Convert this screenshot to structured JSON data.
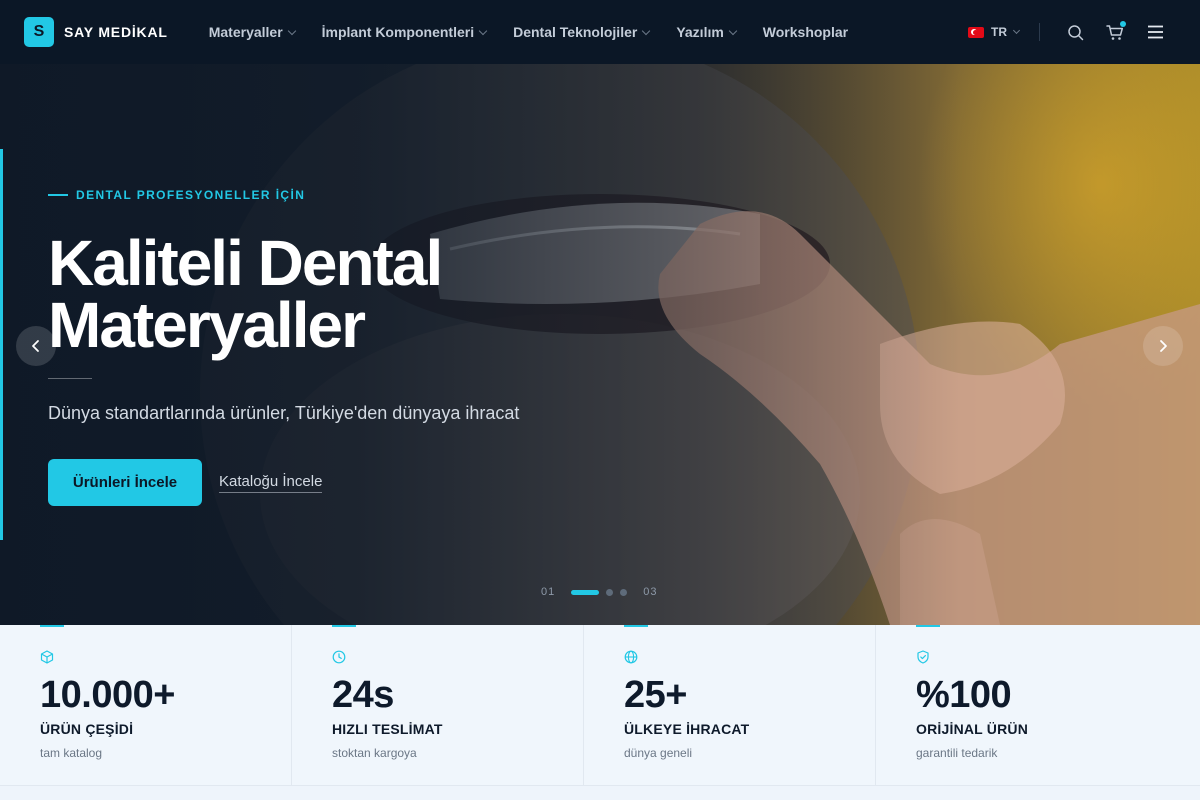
{
  "brand": {
    "logo_letter": "S",
    "name": "SAY MEDİKAL"
  },
  "nav": {
    "items": [
      {
        "label": "Materyaller",
        "has_dropdown": true
      },
      {
        "label": "İmplant Komponentleri",
        "has_dropdown": true
      },
      {
        "label": "Dental Teknolojiler",
        "has_dropdown": true
      },
      {
        "label": "Yazılım",
        "has_dropdown": true
      },
      {
        "label": "Workshoplar",
        "has_dropdown": false
      }
    ]
  },
  "header_actions": {
    "language": "TR",
    "icons": [
      "search-icon",
      "cart-icon",
      "menu-icon"
    ],
    "cart_has_items": true
  },
  "hero": {
    "eyebrow": "DENTAL PROFESYONELLER İÇİN",
    "title": "Kaliteli Dental Materyaller",
    "subtitle": "Dünya standartlarında ürünler, Türkiye'den dünyaya ihracat",
    "primary_cta": "Ürünleri İncele",
    "secondary_cta": "Kataloğu İncele",
    "slider": {
      "current_label": "01",
      "total_label": "03",
      "active_index": 0,
      "count": 3
    }
  },
  "stats": [
    {
      "icon": "box-icon",
      "value": "10.000+",
      "label": "ÜRÜN ÇEŞİDİ",
      "sub": "tam katalog"
    },
    {
      "icon": "clock-icon",
      "value": "24s",
      "label": "HIZLI TESLİMAT",
      "sub": "stoktan kargoya"
    },
    {
      "icon": "globe-icon",
      "value": "25+",
      "label": "ÜLKEYE İHRACAT",
      "sub": "dünya geneli"
    },
    {
      "icon": "shield-check-icon",
      "value": "%100",
      "label": "ORİJİNAL ÜRÜN",
      "sub": "garantili tedarik"
    }
  ],
  "colors": {
    "accent": "#22c8e5",
    "header_bg": "#0b1726",
    "stats_bg": "#f0f6fc"
  }
}
